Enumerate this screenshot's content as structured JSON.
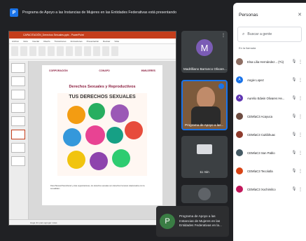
{
  "presenting_bar": {
    "text": "Programa de Apoyo a las Instancias de Mujeres en las Entidades Federativas está presentando"
  },
  "powerpoint": {
    "title": "CAPACITACIÓN_Derechos Sexuales.pptx - PowerPoint",
    "tabs": [
      "Archivo",
      "Inicio",
      "Insertar",
      "Diseño",
      "Transiciones",
      "Animaciones",
      "Presentación",
      "Revisar",
      "Vista"
    ],
    "status": "Haga clic para agregar notas"
  },
  "slide": {
    "logo_left": "CORPORACIÓN",
    "logo_mid": "CONAPO",
    "logo_right": "INMUJERES",
    "heading": "Derechos Sexuales y Reproductivos",
    "poster_title": "TUS DERECHOS SEXUALES",
    "footer": "Para Planned Parenthood y otras organizaciones, los derechos sexuales son derechos humanos relacionados con la sexualidad..."
  },
  "tiles": {
    "m_tile": {
      "initial": "M",
      "name": "Madrilliano Barranco Olivare..."
    },
    "presenter_tile": {
      "name": "Programa de Apoyo a las..."
    },
    "third_tile": {
      "name": "11 min"
    }
  },
  "bottom_chip": {
    "initial": "P",
    "text": "Programa de Apoyo a las Instancias de Mujeres en las Entidades Federativas en la..."
  },
  "people_panel": {
    "title": "Personas",
    "search_placeholder": "Buscar a gente",
    "section": "En la llamada",
    "people": [
      {
        "name": "Elsa Lilia Hernández... (Tú)",
        "color": "#8d6e63",
        "initial": ""
      },
      {
        "name": "Angie Lopez",
        "color": "#1a73e8",
        "initial": "A"
      },
      {
        "name": "Aurelio Edwin Olivares He...",
        "color": "#5e35b1",
        "initial": "A"
      },
      {
        "name": "CEMÍaC3 Acayuca",
        "color": "#6d4c41",
        "initial": ""
      },
      {
        "name": "CEMÍaC3 Cuitláhuac",
        "color": "#8e3b2d",
        "initial": ""
      },
      {
        "name": "CEMÍaC3 San Pablo",
        "color": "#455a64",
        "initial": ""
      },
      {
        "name": "CEMÍaC3 Tecolutla",
        "color": "#d84315",
        "initial": ""
      },
      {
        "name": "CEMÍaC3 Xochimilco",
        "color": "#c2185b",
        "initial": ""
      }
    ]
  }
}
